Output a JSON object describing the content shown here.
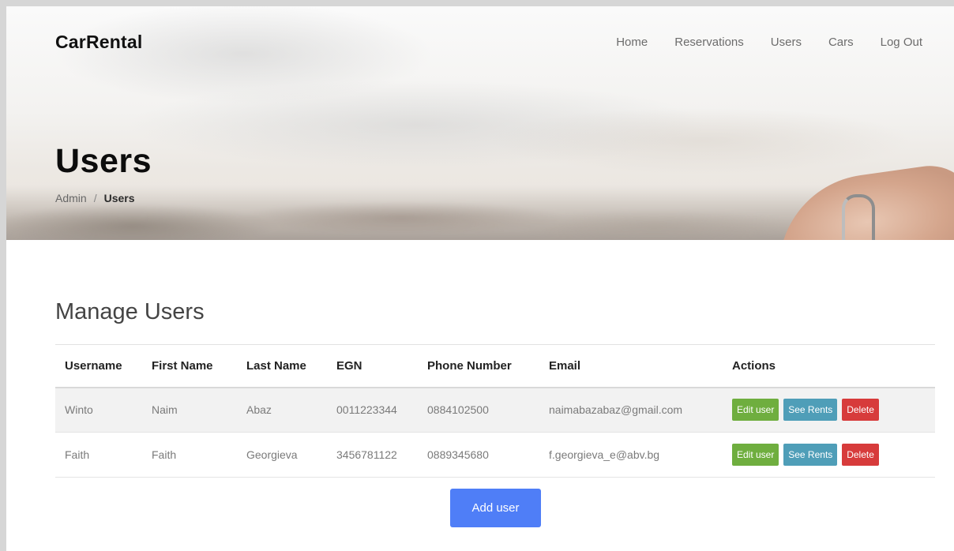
{
  "brand": "CarRental",
  "nav": [
    "Home",
    "Reservations",
    "Users",
    "Cars",
    "Log Out"
  ],
  "hero": {
    "title": "Users",
    "breadcrumb": {
      "parent": "Admin",
      "separator": "/",
      "current": "Users"
    }
  },
  "section_title": "Manage Users",
  "table": {
    "headers": [
      "Username",
      "First Name",
      "Last Name",
      "EGN",
      "Phone Number",
      "Email",
      "Actions"
    ],
    "rows": [
      {
        "username": "Winto",
        "first_name": "Naim",
        "last_name": "Abaz",
        "egn": "0011223344",
        "phone": "0884102500",
        "email": "naimabazabaz@gmail.com"
      },
      {
        "username": "Faith",
        "first_name": "Faith",
        "last_name": "Georgieva",
        "egn": "3456781122",
        "phone": "0889345680",
        "email": "f.georgieva_e@abv.bg"
      }
    ],
    "actions": {
      "edit": "Edit user",
      "rents": "See Rents",
      "delete": "Delete"
    }
  },
  "add_button": "Add user",
  "colors": {
    "edit_button": "#6fae3f",
    "rents_button": "#4f9eb8",
    "delete_button": "#d73b3b",
    "add_button": "#4f7ef7"
  }
}
